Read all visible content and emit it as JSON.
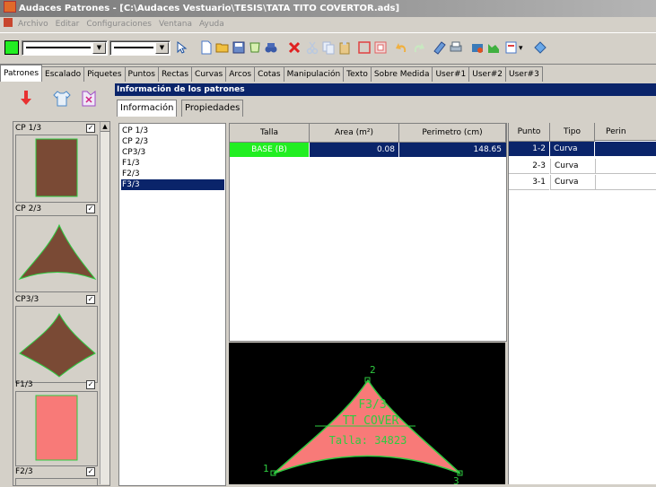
{
  "window": {
    "title": "Audaces Patrones - [C:\\Audaces Vestuario\\TESIS\\TATA TITO COVERTOR.ads]"
  },
  "menu": [
    "Archivo",
    "Editar",
    "Configuraciones",
    "Ventana",
    "Ayuda"
  ],
  "toolbar": {
    "color": "#22ee22"
  },
  "tabs": [
    "Patrones",
    "Escalado",
    "Piquetes",
    "Puntos",
    "Rectas",
    "Curvas",
    "Arcos",
    "Cotas",
    "Manipulación",
    "Texto",
    "Sobre Medida",
    "User#1",
    "User#2",
    "User#3"
  ],
  "thumbnails": [
    {
      "label": "CP 1/3",
      "checked": true,
      "shape": "rect",
      "fill": "#7a4a35"
    },
    {
      "label": "CP 2/3",
      "checked": true,
      "shape": "dome",
      "fill": "#7a4a35"
    },
    {
      "label": "CP3/3",
      "checked": true,
      "shape": "dome",
      "fill": "#7a4a35"
    },
    {
      "label": "F1/3",
      "checked": true,
      "shape": "rect",
      "fill": "#f87a78"
    },
    {
      "label": "F2/3",
      "checked": true,
      "shape": "rect",
      "fill": "#f87a78"
    }
  ],
  "info_header": "Información de los patrones",
  "subtabs": [
    "Información",
    "Propiedades"
  ],
  "pattern_list": [
    "CP 1/3",
    "CP 2/3",
    "CP3/3",
    "F1/3",
    "F2/3",
    "F3/3"
  ],
  "pattern_selected": "F3/3",
  "size_table": {
    "headers": [
      "Talla",
      "Area (m²)",
      "Perimetro (cm)"
    ],
    "rows": [
      {
        "size": "BASE (B)",
        "area": "0.08",
        "perimeter": "148.65"
      }
    ]
  },
  "point_table": {
    "headers": [
      "Punto",
      "Tipo",
      "Perin"
    ],
    "rows": [
      {
        "point": "1-2",
        "type": "Curva"
      },
      {
        "point": "2-3",
        "type": "Curva"
      },
      {
        "point": "3-1",
        "type": "Curva"
      }
    ]
  },
  "preview": {
    "fill": "#f87a78",
    "outline": "#2ecc40",
    "text_lines": [
      "F3/3",
      "TT COVER",
      "Talla: 34823"
    ],
    "points": [
      "1",
      "2",
      "3"
    ]
  }
}
